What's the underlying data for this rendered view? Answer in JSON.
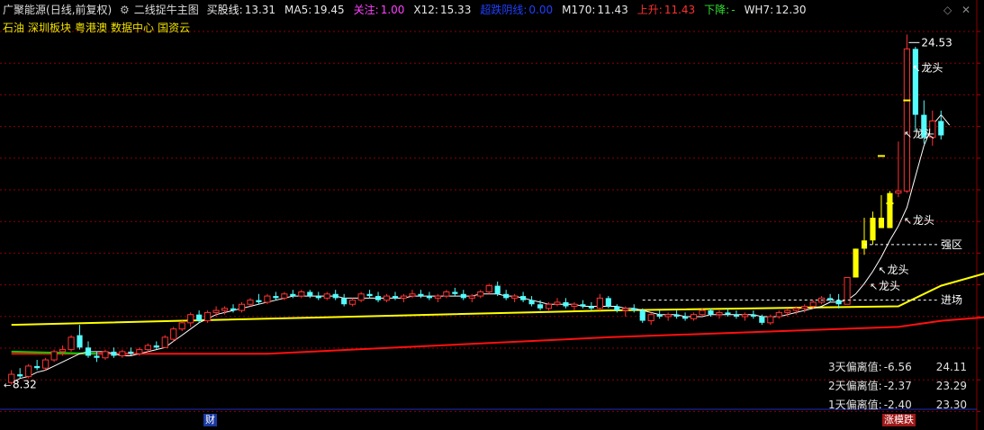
{
  "header": {
    "stock_name": "广聚能源",
    "period": "(日线,前复权)",
    "formula_name": "二线捉牛主图",
    "items": [
      {
        "label": "买股线:",
        "value": "13.31",
        "color": "#e8e8e8"
      },
      {
        "label": "MA5:",
        "value": "19.45",
        "color": "#e8e8e8"
      },
      {
        "label": "关注:",
        "value": "1.00",
        "color": "#ff40ff"
      },
      {
        "label": "X12:",
        "value": "15.33",
        "color": "#e8e8e8"
      },
      {
        "label": "超跌阴线:",
        "value": "0.00",
        "color": "#2040ff"
      },
      {
        "label": "M170:",
        "value": "11.43",
        "color": "#e8e8e8"
      },
      {
        "label": "上升:",
        "value": "11.43",
        "color": "#ff3030"
      },
      {
        "label": "下降:",
        "value": "-",
        "color": "#30e030"
      },
      {
        "label": "WH7:",
        "value": "12.30",
        "color": "#e8e8e8"
      }
    ]
  },
  "concepts": [
    "石油",
    "深圳板块",
    "粤港澳",
    "数据中心",
    "国资云"
  ],
  "annotations": {
    "high_label": "24.53",
    "low_label": "8.32",
    "dragon": "龙头",
    "strong_zone": "强区",
    "entry": "进场"
  },
  "deviation": [
    {
      "label": "3天偏离值:",
      "value": "-6.56",
      "price": "24.11"
    },
    {
      "label": "2天偏离值:",
      "value": "-2.37",
      "price": "23.29"
    },
    {
      "label": "1天偏离值:",
      "value": "-2.40",
      "price": "23.30"
    }
  ],
  "bottom_tags": {
    "finance": "财",
    "limit": "涨模跌"
  },
  "colors": {
    "up": "#ff3232",
    "down": "#54fcfc",
    "yellow": "#ffff00",
    "ma": "#ffffff",
    "red_line": "#ff1010",
    "green_line": "#00d000",
    "grid": "#8b0000"
  },
  "chart_data": {
    "type": "candlestick",
    "ylim": [
      7.0,
      26.0
    ],
    "candles": [
      [
        8.3,
        8.9,
        8.2,
        8.7
      ],
      [
        8.7,
        9.0,
        8.5,
        8.6
      ],
      [
        8.6,
        9.2,
        8.5,
        9.1
      ],
      [
        9.1,
        9.4,
        8.9,
        9.0
      ],
      [
        9.0,
        9.5,
        8.9,
        9.4
      ],
      [
        9.4,
        9.9,
        9.3,
        9.8
      ],
      [
        9.8,
        10.1,
        9.6,
        9.9
      ],
      [
        9.9,
        10.6,
        9.8,
        10.5
      ],
      [
        10.6,
        11.1,
        9.9,
        10.0
      ],
      [
        10.0,
        10.3,
        9.5,
        9.6
      ],
      [
        9.6,
        9.8,
        9.3,
        9.5
      ],
      [
        9.5,
        9.9,
        9.4,
        9.8
      ],
      [
        9.8,
        10.0,
        9.5,
        9.6
      ],
      [
        9.6,
        9.9,
        9.5,
        9.8
      ],
      [
        9.8,
        10.0,
        9.6,
        9.7
      ],
      [
        9.7,
        10.0,
        9.6,
        9.9
      ],
      [
        9.9,
        10.2,
        9.8,
        10.1
      ],
      [
        10.1,
        10.3,
        9.9,
        10.0
      ],
      [
        10.0,
        10.6,
        10.0,
        10.5
      ],
      [
        10.4,
        11.0,
        10.3,
        10.9
      ],
      [
        10.9,
        11.3,
        10.8,
        11.2
      ],
      [
        11.2,
        11.7,
        11.0,
        11.6
      ],
      [
        11.6,
        11.8,
        11.2,
        11.3
      ],
      [
        11.3,
        11.8,
        11.2,
        11.7
      ],
      [
        11.7,
        12.0,
        11.5,
        11.8
      ],
      [
        11.8,
        12.0,
        11.6,
        11.9
      ],
      [
        11.9,
        12.1,
        11.7,
        11.8
      ],
      [
        11.8,
        12.2,
        11.7,
        12.1
      ],
      [
        12.1,
        12.4,
        12.0,
        12.3
      ],
      [
        12.3,
        12.6,
        12.1,
        12.2
      ],
      [
        12.2,
        12.6,
        12.1,
        12.5
      ],
      [
        12.5,
        12.7,
        12.3,
        12.4
      ],
      [
        12.4,
        12.7,
        12.3,
        12.6
      ],
      [
        12.6,
        12.8,
        12.4,
        12.5
      ],
      [
        12.5,
        12.8,
        12.4,
        12.7
      ],
      [
        12.7,
        12.8,
        12.4,
        12.5
      ],
      [
        12.5,
        12.7,
        12.3,
        12.4
      ],
      [
        12.4,
        12.7,
        12.3,
        12.6
      ],
      [
        12.6,
        12.8,
        12.3,
        12.4
      ],
      [
        12.4,
        12.6,
        12.0,
        12.1
      ],
      [
        12.1,
        12.4,
        12.0,
        12.3
      ],
      [
        12.3,
        12.7,
        12.2,
        12.6
      ],
      [
        12.6,
        12.8,
        12.4,
        12.5
      ],
      [
        12.5,
        12.7,
        12.2,
        12.3
      ],
      [
        12.3,
        12.6,
        12.2,
        12.5
      ],
      [
        12.5,
        12.7,
        12.3,
        12.4
      ],
      [
        12.4,
        12.6,
        12.2,
        12.5
      ],
      [
        12.5,
        12.8,
        12.4,
        12.6
      ],
      [
        12.6,
        12.8,
        12.4,
        12.5
      ],
      [
        12.5,
        12.7,
        12.3,
        12.4
      ],
      [
        12.4,
        12.6,
        12.2,
        12.5
      ],
      [
        12.5,
        12.8,
        12.4,
        12.7
      ],
      [
        12.7,
        12.9,
        12.5,
        12.6
      ],
      [
        12.6,
        12.8,
        12.3,
        12.4
      ],
      [
        12.4,
        12.6,
        12.2,
        12.5
      ],
      [
        12.5,
        12.8,
        12.4,
        12.7
      ],
      [
        12.7,
        13.1,
        12.6,
        13.0
      ],
      [
        13.0,
        13.2,
        12.5,
        12.6
      ],
      [
        12.6,
        12.8,
        12.3,
        12.4
      ],
      [
        12.4,
        12.6,
        12.2,
        12.5
      ],
      [
        12.5,
        12.7,
        12.2,
        12.3
      ],
      [
        12.3,
        12.5,
        12.0,
        12.1
      ],
      [
        12.1,
        12.3,
        11.8,
        11.9
      ],
      [
        11.9,
        12.2,
        11.8,
        12.1
      ],
      [
        12.1,
        12.4,
        12.0,
        12.2
      ],
      [
        12.2,
        12.4,
        11.9,
        12.0
      ],
      [
        12.0,
        12.2,
        11.8,
        12.1
      ],
      [
        12.1,
        12.3,
        11.9,
        12.0
      ],
      [
        12.0,
        12.2,
        11.8,
        11.9
      ],
      [
        11.9,
        12.6,
        11.8,
        12.4
      ],
      [
        12.4,
        12.5,
        11.9,
        12.0
      ],
      [
        12.0,
        12.1,
        11.7,
        11.8
      ],
      [
        11.8,
        12.0,
        11.5,
        11.9
      ],
      [
        11.9,
        12.1,
        11.7,
        11.8
      ],
      [
        11.8,
        11.9,
        11.2,
        11.3
      ],
      [
        11.3,
        11.7,
        11.1,
        11.6
      ],
      [
        11.6,
        11.8,
        11.4,
        11.5
      ],
      [
        11.5,
        11.7,
        11.3,
        11.6
      ],
      [
        11.6,
        11.8,
        11.4,
        11.5
      ],
      [
        11.5,
        11.7,
        11.3,
        11.4
      ],
      [
        11.4,
        11.7,
        11.3,
        11.6
      ],
      [
        11.6,
        11.9,
        11.5,
        11.8
      ],
      [
        11.8,
        11.9,
        11.5,
        11.6
      ],
      [
        11.6,
        11.8,
        11.4,
        11.7
      ],
      [
        11.7,
        11.9,
        11.5,
        11.6
      ],
      [
        11.6,
        11.8,
        11.4,
        11.5
      ],
      [
        11.5,
        11.7,
        11.3,
        11.6
      ],
      [
        11.6,
        11.8,
        11.4,
        11.5
      ],
      [
        11.5,
        11.6,
        11.1,
        11.2
      ],
      [
        11.2,
        11.6,
        11.1,
        11.5
      ],
      [
        11.5,
        11.8,
        11.4,
        11.7
      ],
      [
        11.7,
        11.9,
        11.5,
        11.8
      ],
      [
        11.8,
        12.0,
        11.6,
        11.9
      ],
      [
        11.9,
        12.1,
        11.7,
        12.0
      ],
      [
        12.0,
        12.3,
        11.9,
        12.2
      ],
      [
        12.2,
        12.5,
        12.1,
        12.4
      ],
      [
        12.4,
        12.6,
        12.2,
        12.3
      ],
      [
        12.3,
        12.6,
        11.9,
        12.1
      ],
      [
        12.1,
        13.4,
        12.1,
        13.4
      ],
      [
        13.4,
        14.8,
        13.4,
        14.8
      ],
      [
        14.8,
        16.3,
        14.5,
        15.2
      ],
      [
        15.2,
        16.6,
        15.0,
        16.3
      ],
      [
        16.3,
        17.4,
        15.8,
        15.8
      ],
      [
        15.8,
        17.6,
        15.8,
        17.5
      ],
      [
        17.5,
        20.0,
        17.3,
        17.6
      ],
      [
        17.6,
        25.2,
        17.5,
        24.5
      ],
      [
        24.5,
        24.6,
        20.5,
        21.3
      ],
      [
        21.3,
        22.0,
        19.9,
        20.2
      ],
      [
        20.2,
        21.5,
        19.8,
        21.0
      ],
      [
        21.0,
        21.5,
        20.1,
        20.3
      ]
    ],
    "ma_short": [
      8.3,
      8.5,
      8.6,
      8.8,
      8.9,
      9.1,
      9.3,
      9.5,
      9.7,
      9.8,
      9.8,
      9.8,
      9.7,
      9.6,
      9.6,
      9.7,
      9.8,
      9.9,
      10.0,
      10.3,
      10.6,
      10.9,
      11.2,
      11.4,
      11.6,
      11.7,
      11.8,
      11.9,
      12.0,
      12.1,
      12.2,
      12.3,
      12.4,
      12.5,
      12.5,
      12.5,
      12.5,
      12.5,
      12.5,
      12.4,
      12.4,
      12.4,
      12.4,
      12.4,
      12.4,
      12.4,
      12.4,
      12.5,
      12.5,
      12.5,
      12.5,
      12.5,
      12.5,
      12.5,
      12.5,
      12.6,
      12.6,
      12.6,
      12.5,
      12.5,
      12.4,
      12.3,
      12.2,
      12.1,
      12.1,
      12.1,
      12.1,
      12.0,
      12.0,
      12.0,
      12.0,
      12.0,
      11.9,
      11.9,
      11.8,
      11.7,
      11.6,
      11.6,
      11.6,
      11.5,
      11.5,
      11.5,
      11.6,
      11.6,
      11.6,
      11.6,
      11.6,
      11.6,
      11.5,
      11.5,
      11.5,
      11.6,
      11.7,
      11.8,
      11.9,
      12.0,
      12.2,
      12.2,
      12.3,
      12.6,
      13.1,
      13.7,
      14.4,
      15.2,
      15.9,
      16.8,
      18.3,
      19.8,
      20.8,
      21.3,
      20.8
    ],
    "buy_line": [
      [
        0,
        11.1
      ],
      [
        40,
        11.5
      ],
      [
        70,
        11.8
      ],
      [
        104,
        12.0
      ],
      [
        109,
        13.0
      ],
      [
        115,
        13.7
      ]
    ],
    "red_line": [
      [
        0,
        9.7
      ],
      [
        30,
        9.7
      ],
      [
        70,
        10.5
      ],
      [
        104,
        11.0
      ],
      [
        109,
        11.3
      ],
      [
        115,
        11.5
      ]
    ],
    "green_line": [
      [
        0,
        9.8
      ],
      [
        10,
        9.7
      ]
    ],
    "strong_zone_price": 15.0,
    "entry_price": 12.3
  }
}
